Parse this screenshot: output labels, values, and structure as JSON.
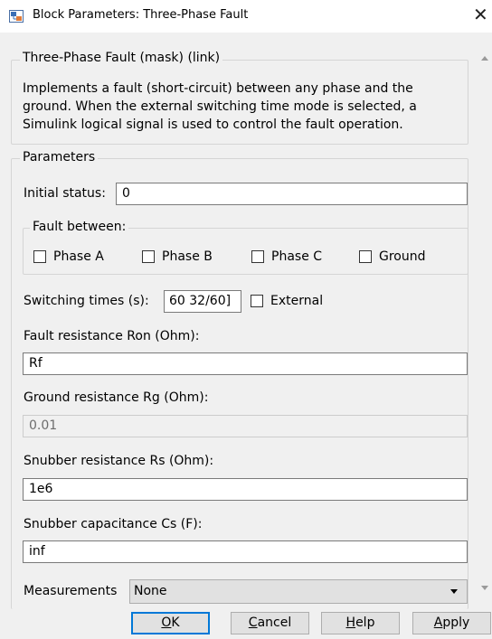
{
  "window": {
    "title": "Block Parameters: Three-Phase Fault",
    "app_icon": "simulink-block-icon",
    "close_glyph": "✕"
  },
  "block": {
    "title": "Three-Phase Fault (mask) (link)",
    "description": "Implements a fault (short-circuit) between any phase and the ground. When the external switching time mode is selected, a Simulink logical signal is used to control the fault operation."
  },
  "parameters": {
    "title": "Parameters",
    "initial_status": {
      "label": "Initial status:",
      "value": "0"
    },
    "fault_between": {
      "title": "Fault between:",
      "options": [
        {
          "label": "Phase A",
          "checked": false
        },
        {
          "label": "Phase B",
          "checked": false
        },
        {
          "label": "Phase C",
          "checked": false
        },
        {
          "label": "Ground",
          "checked": false
        }
      ]
    },
    "switching_times": {
      "label": "Switching times (s):",
      "value": "60  32/60]",
      "external_label": "External",
      "external_checked": false
    },
    "fault_resistance": {
      "label": "Fault resistance Ron (Ohm):",
      "value": "Rf"
    },
    "ground_resistance": {
      "label": "Ground resistance Rg (Ohm):",
      "value": "0.01",
      "disabled": true
    },
    "snubber_resistance": {
      "label": "Snubber resistance Rs (Ohm):",
      "value": "1e6"
    },
    "snubber_capacitance": {
      "label": "Snubber capacitance Cs (F):",
      "value": "inf"
    },
    "measurements": {
      "label": "Measurements",
      "value": "None"
    }
  },
  "buttons": {
    "ok": {
      "mnemonic": "O",
      "rest": "K"
    },
    "cancel": {
      "mnemonic": "C",
      "rest": "ancel"
    },
    "help": {
      "mnemonic": "H",
      "rest": "elp"
    },
    "apply": {
      "mnemonic": "A",
      "rest": "pply"
    }
  },
  "colors": {
    "default_button_border": "#0078d7",
    "window_bg": "#f0f0f0"
  }
}
